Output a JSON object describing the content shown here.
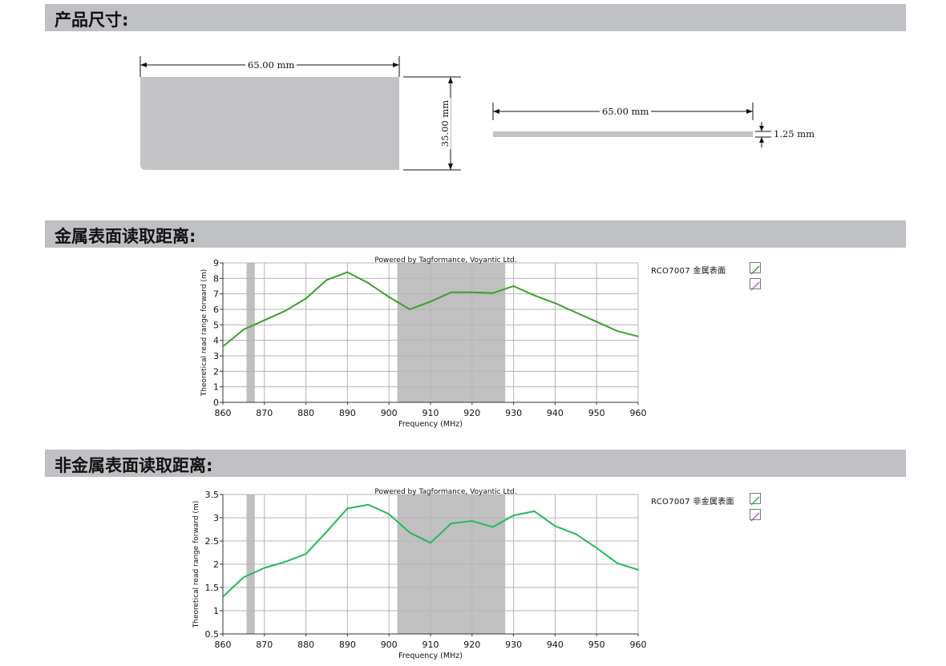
{
  "sections": {
    "dimensions_title": "产品尺寸:",
    "metal_title": "金属表面读取距离:",
    "nonmetal_title": "非金属表面读取距离:"
  },
  "dimensions": {
    "front_width": "65.00 mm",
    "front_height": "35.00 mm",
    "side_width": "65.00 mm",
    "side_thickness": "1.25 mm"
  },
  "colors": {
    "section_bar": "#bfc0c3",
    "tag_fill": "#c3c3c5",
    "band_fill": "#c0c0c0",
    "metal_line": "#3aa12a",
    "nonmetal_line": "#25b85a",
    "legend_secondary": "#d14bd1"
  },
  "chart_data": [
    {
      "type": "line",
      "title": "Powered by Tagformance, Voyantic Ltd.",
      "xlabel": "Frequency (MHz)",
      "ylabel": "Theoretical read range forward (m)",
      "xlim": [
        860,
        960
      ],
      "ylim": [
        0,
        9
      ],
      "xticks": [
        860,
        870,
        880,
        890,
        900,
        910,
        920,
        930,
        940,
        950,
        960
      ],
      "yticks": [
        0,
        1,
        2,
        3,
        4,
        5,
        6,
        7,
        8,
        9
      ],
      "grid": true,
      "legend_position": "right",
      "legend_entries": [
        "RCO7007 金属表面",
        ""
      ],
      "shaded_bands": [
        [
          865.7,
          867.7
        ],
        [
          902,
          928
        ]
      ],
      "series": [
        {
          "name": "RCO7007 金属表面",
          "color": "#3aa12a",
          "x": [
            860,
            865,
            870,
            875,
            880,
            885,
            890,
            895,
            900,
            905,
            910,
            915,
            920,
            925,
            930,
            935,
            940,
            945,
            950,
            955,
            960
          ],
          "y": [
            3.6,
            4.7,
            5.3,
            5.9,
            6.7,
            7.9,
            8.4,
            7.7,
            6.8,
            6.0,
            6.5,
            7.1,
            7.1,
            7.05,
            7.5,
            6.9,
            6.4,
            5.8,
            5.2,
            4.6,
            4.25
          ]
        }
      ]
    },
    {
      "type": "line",
      "title": "Powered by Tagformance, Voyantic Ltd.",
      "xlabel": "Frequency (MHz)",
      "ylabel": "Theoretical read range forward (m)",
      "xlim": [
        860,
        960
      ],
      "ylim": [
        0.5,
        3.5
      ],
      "xticks": [
        860,
        870,
        880,
        890,
        900,
        910,
        920,
        930,
        940,
        950,
        960
      ],
      "yticks": [
        "0.5",
        "1",
        "1.5",
        "2",
        "2.5",
        "3",
        "3.5"
      ],
      "grid": true,
      "legend_position": "right",
      "legend_entries": [
        "RCO7007 非金属表面",
        ""
      ],
      "shaded_bands": [
        [
          865.7,
          867.7
        ],
        [
          902,
          928
        ]
      ],
      "series": [
        {
          "name": "RCO7007 非金属表面",
          "color": "#25b85a",
          "x": [
            860,
            865,
            870,
            875,
            880,
            885,
            890,
            895,
            900,
            905,
            910,
            915,
            920,
            925,
            930,
            935,
            940,
            945,
            950,
            955,
            960
          ],
          "y": [
            1.3,
            1.72,
            1.92,
            2.05,
            2.22,
            2.7,
            3.2,
            3.28,
            3.08,
            2.68,
            2.46,
            2.88,
            2.93,
            2.8,
            3.05,
            3.14,
            2.82,
            2.65,
            2.35,
            2.02,
            1.88
          ]
        }
      ]
    }
  ]
}
